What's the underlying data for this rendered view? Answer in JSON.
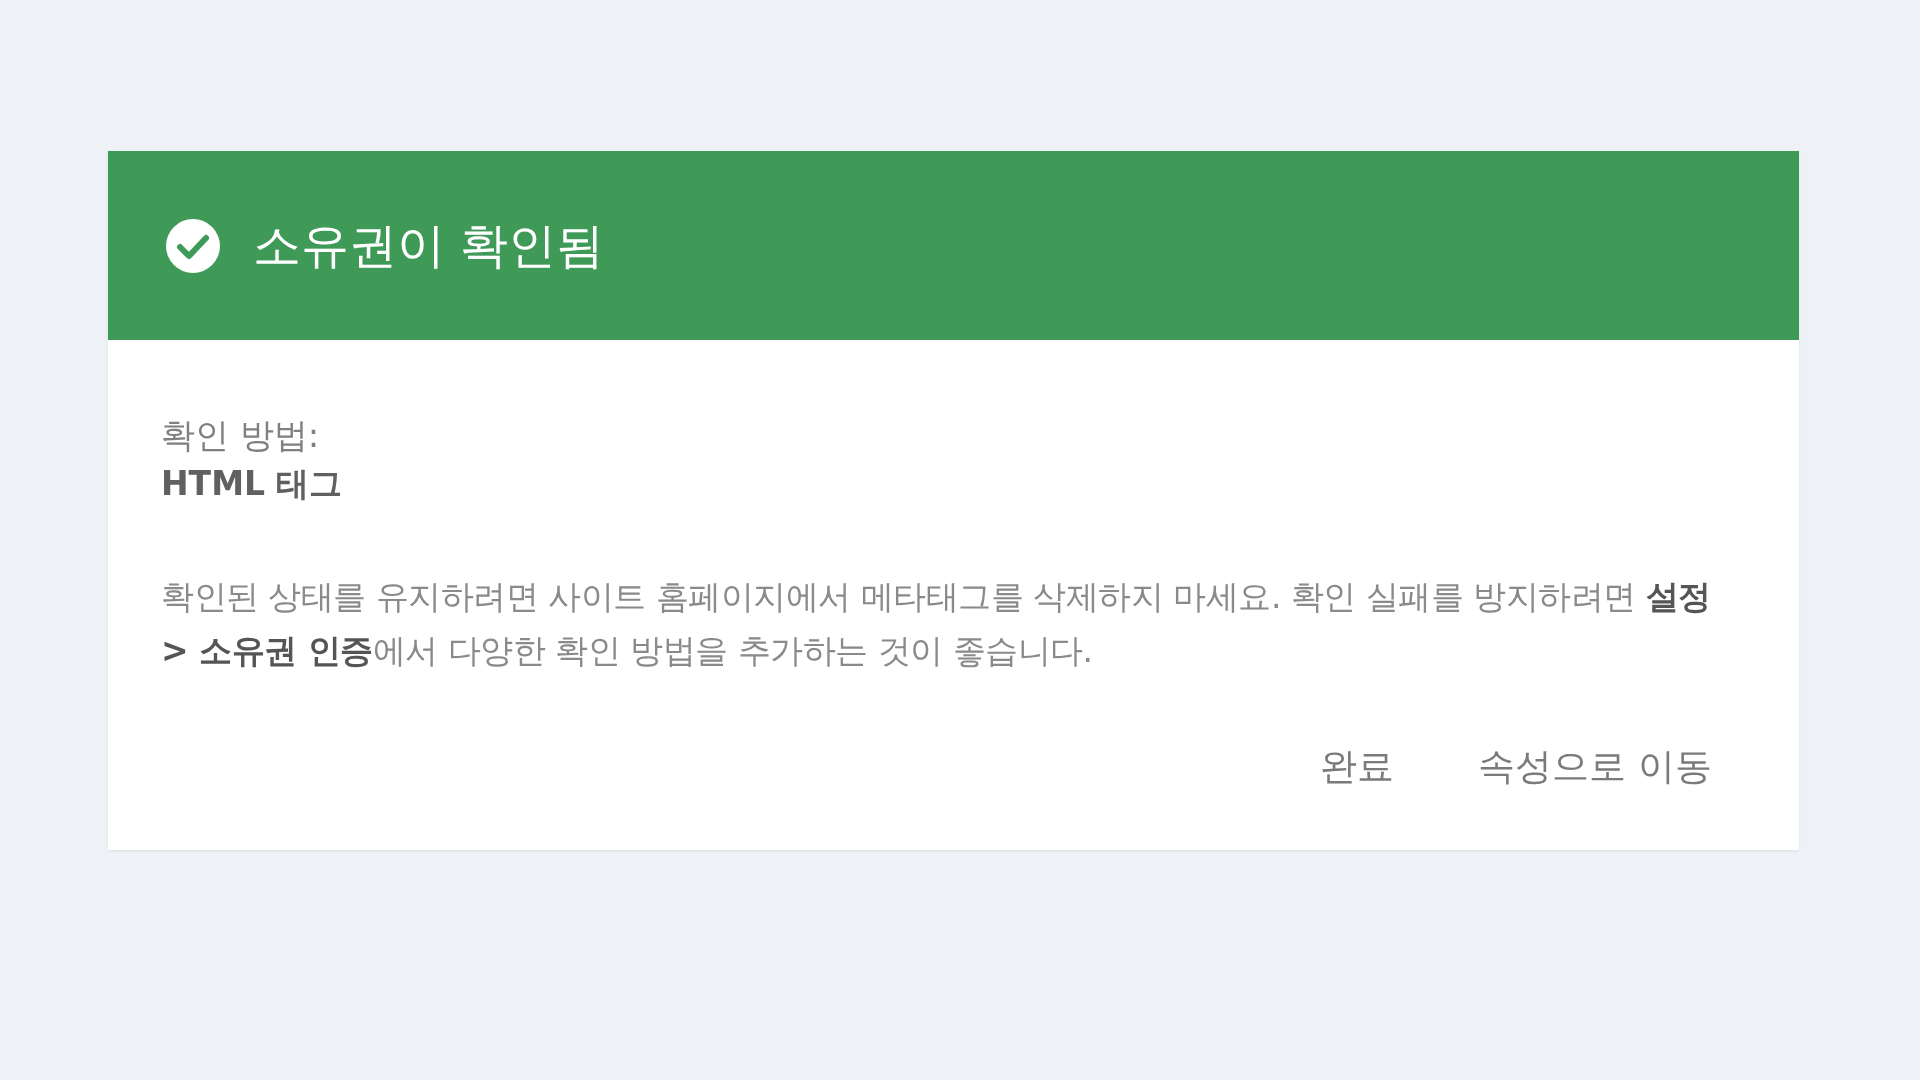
{
  "dialog": {
    "title": "소유권이 확인됨",
    "method_label": "확인 방법:",
    "method_value": "HTML 태그",
    "message": "확인된 상태를 유지하려면 사이트 홈페이지에서 메타태그를 삭제하지 마세요. 확인 실패를 방지하려면 **설정 > 소유권 인증**에서 다양한 확인 방법을 추가하는 것이 좋습니다.",
    "buttons": [
      {
        "label": "완료"
      },
      {
        "label": "속성으로 이동"
      }
    ]
  }
}
